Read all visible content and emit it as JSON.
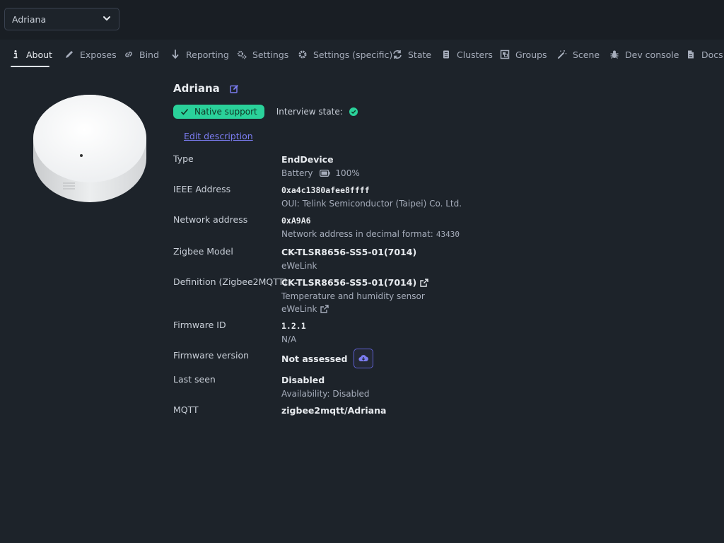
{
  "device_select": {
    "value": "Adriana"
  },
  "tabs": [
    {
      "label": "About",
      "icon": "info-icon"
    },
    {
      "label": "Exposes",
      "icon": "pencil-icon"
    },
    {
      "label": "Bind",
      "icon": "link-icon"
    },
    {
      "label": "Reporting",
      "icon": "download-arrow-icon"
    },
    {
      "label": "Settings",
      "icon": "cogs-icon"
    },
    {
      "label": "Settings (specific)",
      "icon": "gear-icon"
    },
    {
      "label": "State",
      "icon": "refresh-icon"
    },
    {
      "label": "Clusters",
      "icon": "document-icon"
    },
    {
      "label": "Groups",
      "icon": "object-group-icon"
    },
    {
      "label": "Scene",
      "icon": "magic-wand-icon"
    },
    {
      "label": "Dev console",
      "icon": "bug-icon"
    },
    {
      "label": "Docs",
      "icon": "file-icon"
    }
  ],
  "device": {
    "name": "Adriana",
    "support_badge": "Native support",
    "interview_label": "Interview state:",
    "edit_description": "Edit description"
  },
  "props": {
    "type": {
      "label": "Type",
      "value": "EndDevice",
      "power": "Battery",
      "battery": "100%"
    },
    "ieee": {
      "label": "IEEE Address",
      "value": "0xa4c1380afee8ffff",
      "oui": "OUI: Telink Semiconductor (Taipei) Co. Ltd."
    },
    "network": {
      "label": "Network address",
      "value": "0xA9A6",
      "decimal_label": "Network address in decimal format:",
      "decimal_value": "43430"
    },
    "model": {
      "label": "Zigbee Model",
      "value": "CK-TLSR8656-SS5-01(7014)",
      "vendor": "eWeLink"
    },
    "definition": {
      "label": "Definition (Zigbee2MQTT)",
      "value": "CK-TLSR8656-SS5-01(7014)",
      "description": "Temperature and humidity sensor",
      "vendor": "eWeLink"
    },
    "firmware_id": {
      "label": "Firmware ID",
      "value": "1.2.1",
      "date": "N/A"
    },
    "firmware_version": {
      "label": "Firmware version",
      "value": "Not assessed"
    },
    "last_seen": {
      "label": "Last seen",
      "value": "Disabled",
      "availability": "Availability: Disabled"
    },
    "mqtt": {
      "label": "MQTT",
      "value": "zigbee2mqtt/Adriana"
    }
  },
  "colors": {
    "background": "#1d232a",
    "topbar": "#191e24",
    "success": "#2ad19a",
    "link": "#7b7cf0"
  }
}
